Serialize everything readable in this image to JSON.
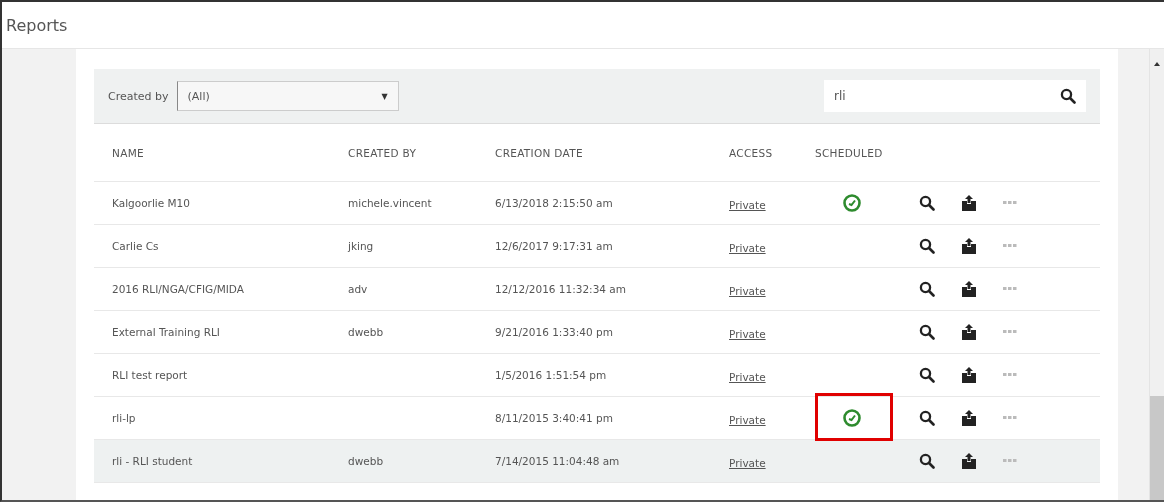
{
  "window": {
    "title": "Reports"
  },
  "filter": {
    "label": "Created by",
    "value": "(All)",
    "arrow": "▼"
  },
  "search": {
    "value": "rli"
  },
  "table": {
    "columns": [
      "NAME",
      "CREATED BY",
      "CREATION DATE",
      "ACCESS",
      "SCHEDULED"
    ],
    "rows": [
      {
        "name": "Kalgoorlie M10",
        "created_by": "michele.vincent",
        "date": "6/13/2018 2:15:50 am",
        "access": "Private",
        "scheduled": true,
        "annotated": false,
        "hovered": false
      },
      {
        "name": "Carlie Cs",
        "created_by": "jking",
        "date": "12/6/2017 9:17:31 am",
        "access": "Private",
        "scheduled": false,
        "annotated": false,
        "hovered": false
      },
      {
        "name": "2016 RLI/NGA/CFIG/MIDA",
        "created_by": "adv",
        "date": "12/12/2016 11:32:34 am",
        "access": "Private",
        "scheduled": false,
        "annotated": false,
        "hovered": false
      },
      {
        "name": "External Training RLI",
        "created_by": "dwebb",
        "date": "9/21/2016 1:33:40 pm",
        "access": "Private",
        "scheduled": false,
        "annotated": false,
        "hovered": false
      },
      {
        "name": "RLI test report",
        "date": "1/5/2016 1:51:54 pm",
        "access": "Private",
        "scheduled": false,
        "annotated": false,
        "hovered": false
      },
      {
        "name": "rli-lp",
        "date": "8/11/2015 3:40:41 pm",
        "access": "Private",
        "scheduled": true,
        "annotated": true,
        "hovered": false
      },
      {
        "name": "rli - RLI student",
        "created_by": "dwebb",
        "date": "7/14/2015 11:04:48 am",
        "access": "Private",
        "scheduled": false,
        "annotated": false,
        "hovered": true
      }
    ]
  }
}
